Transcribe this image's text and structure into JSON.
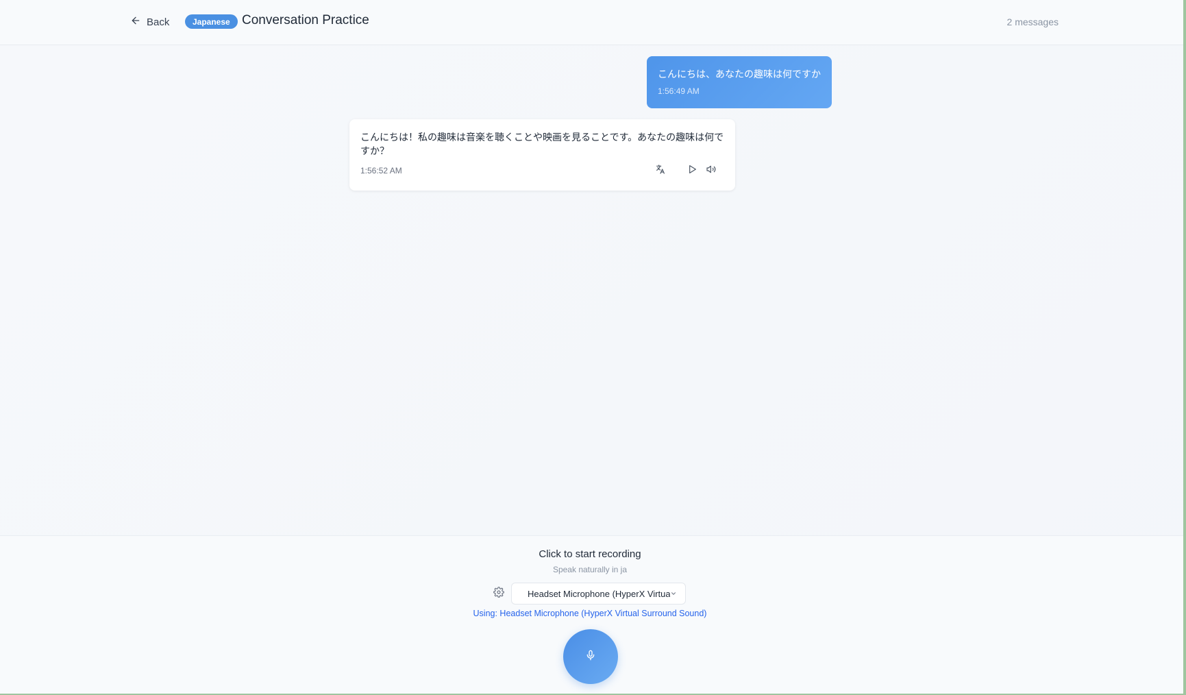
{
  "header": {
    "back_label": "Back",
    "language_badge": "Japanese",
    "title": "Conversation Practice",
    "message_count": "2 messages"
  },
  "messages": [
    {
      "role": "user",
      "text": "こんにちは、あなたの趣味は何ですか",
      "time": "1:56:49 AM"
    },
    {
      "role": "assistant",
      "text": "こんにちは！私の趣味は音楽を聴くことや映画を見ることです。あなたの趣味は何ですか？",
      "time": "1:56:52 AM"
    }
  ],
  "footer": {
    "record_title": "Click to start recording",
    "record_subtitle": "Speak naturally in ja",
    "mic_selected": "Headset Microphone (HyperX Virtual...",
    "using_text": "Using: Headset Microphone (HyperX Virtual Surround Sound)"
  },
  "icons": {
    "back": "arrow-left-icon",
    "translate": "translate-icon",
    "play": "play-icon",
    "speaker": "speaker-icon",
    "settings": "gear-icon",
    "dropdown": "chevron-down-icon",
    "mic": "microphone-icon"
  },
  "colors": {
    "accent": "#4a90e2",
    "link": "#2563eb"
  }
}
